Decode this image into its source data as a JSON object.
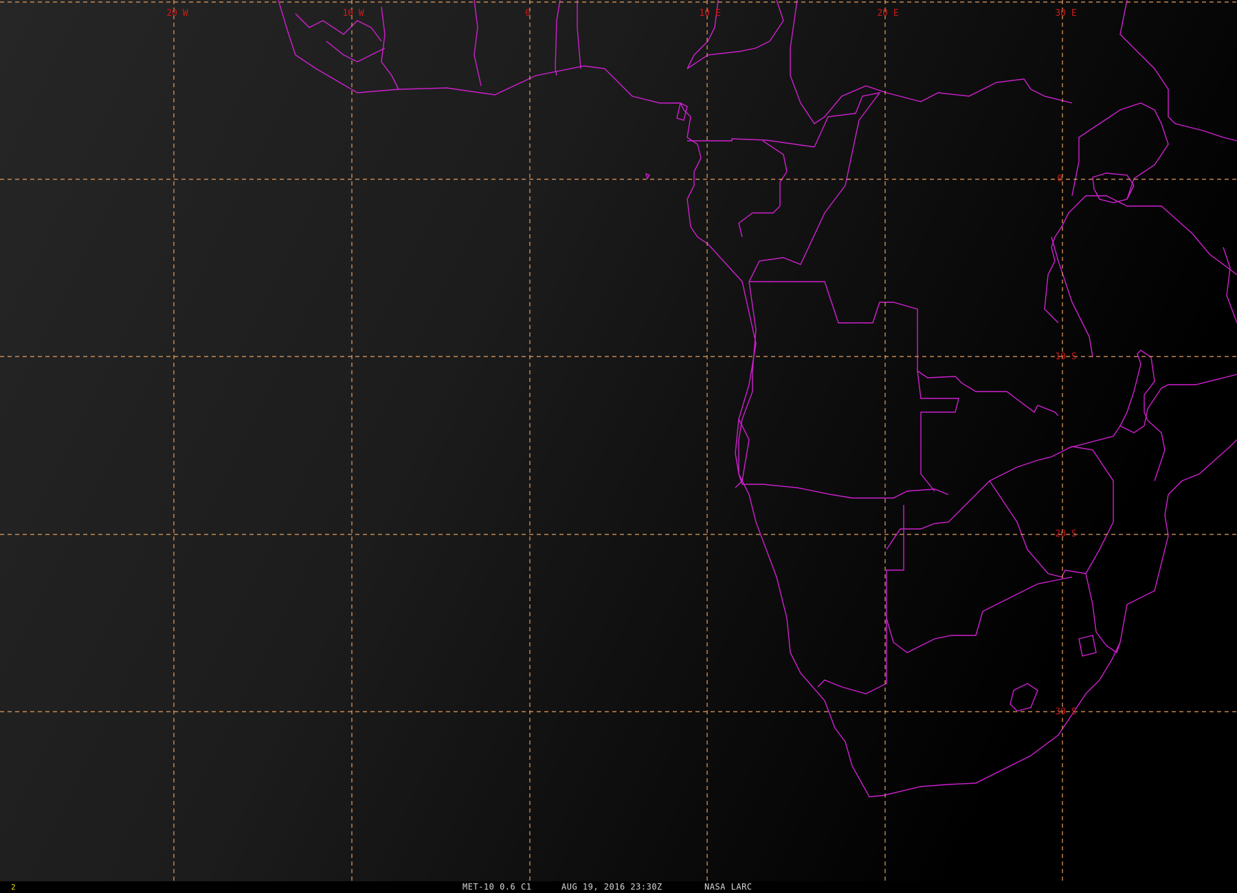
{
  "colors": {
    "grid": "#e8a060",
    "grid_label": "#cc1a1a",
    "borders": "#d020d0",
    "background": "#000000"
  },
  "map": {
    "longitude_labels": [
      "20 W",
      "10 W",
      "0",
      "10 E",
      "20 E",
      "30 E"
    ],
    "latitude_labels": [
      "0",
      "10 S",
      "20 S",
      "30 S"
    ]
  },
  "status": {
    "frame_number": "2",
    "satellite_band": "MET-10 0.6 C1",
    "datetime": "AUG 19, 2016 23:30Z",
    "source": "NASA LARC"
  }
}
